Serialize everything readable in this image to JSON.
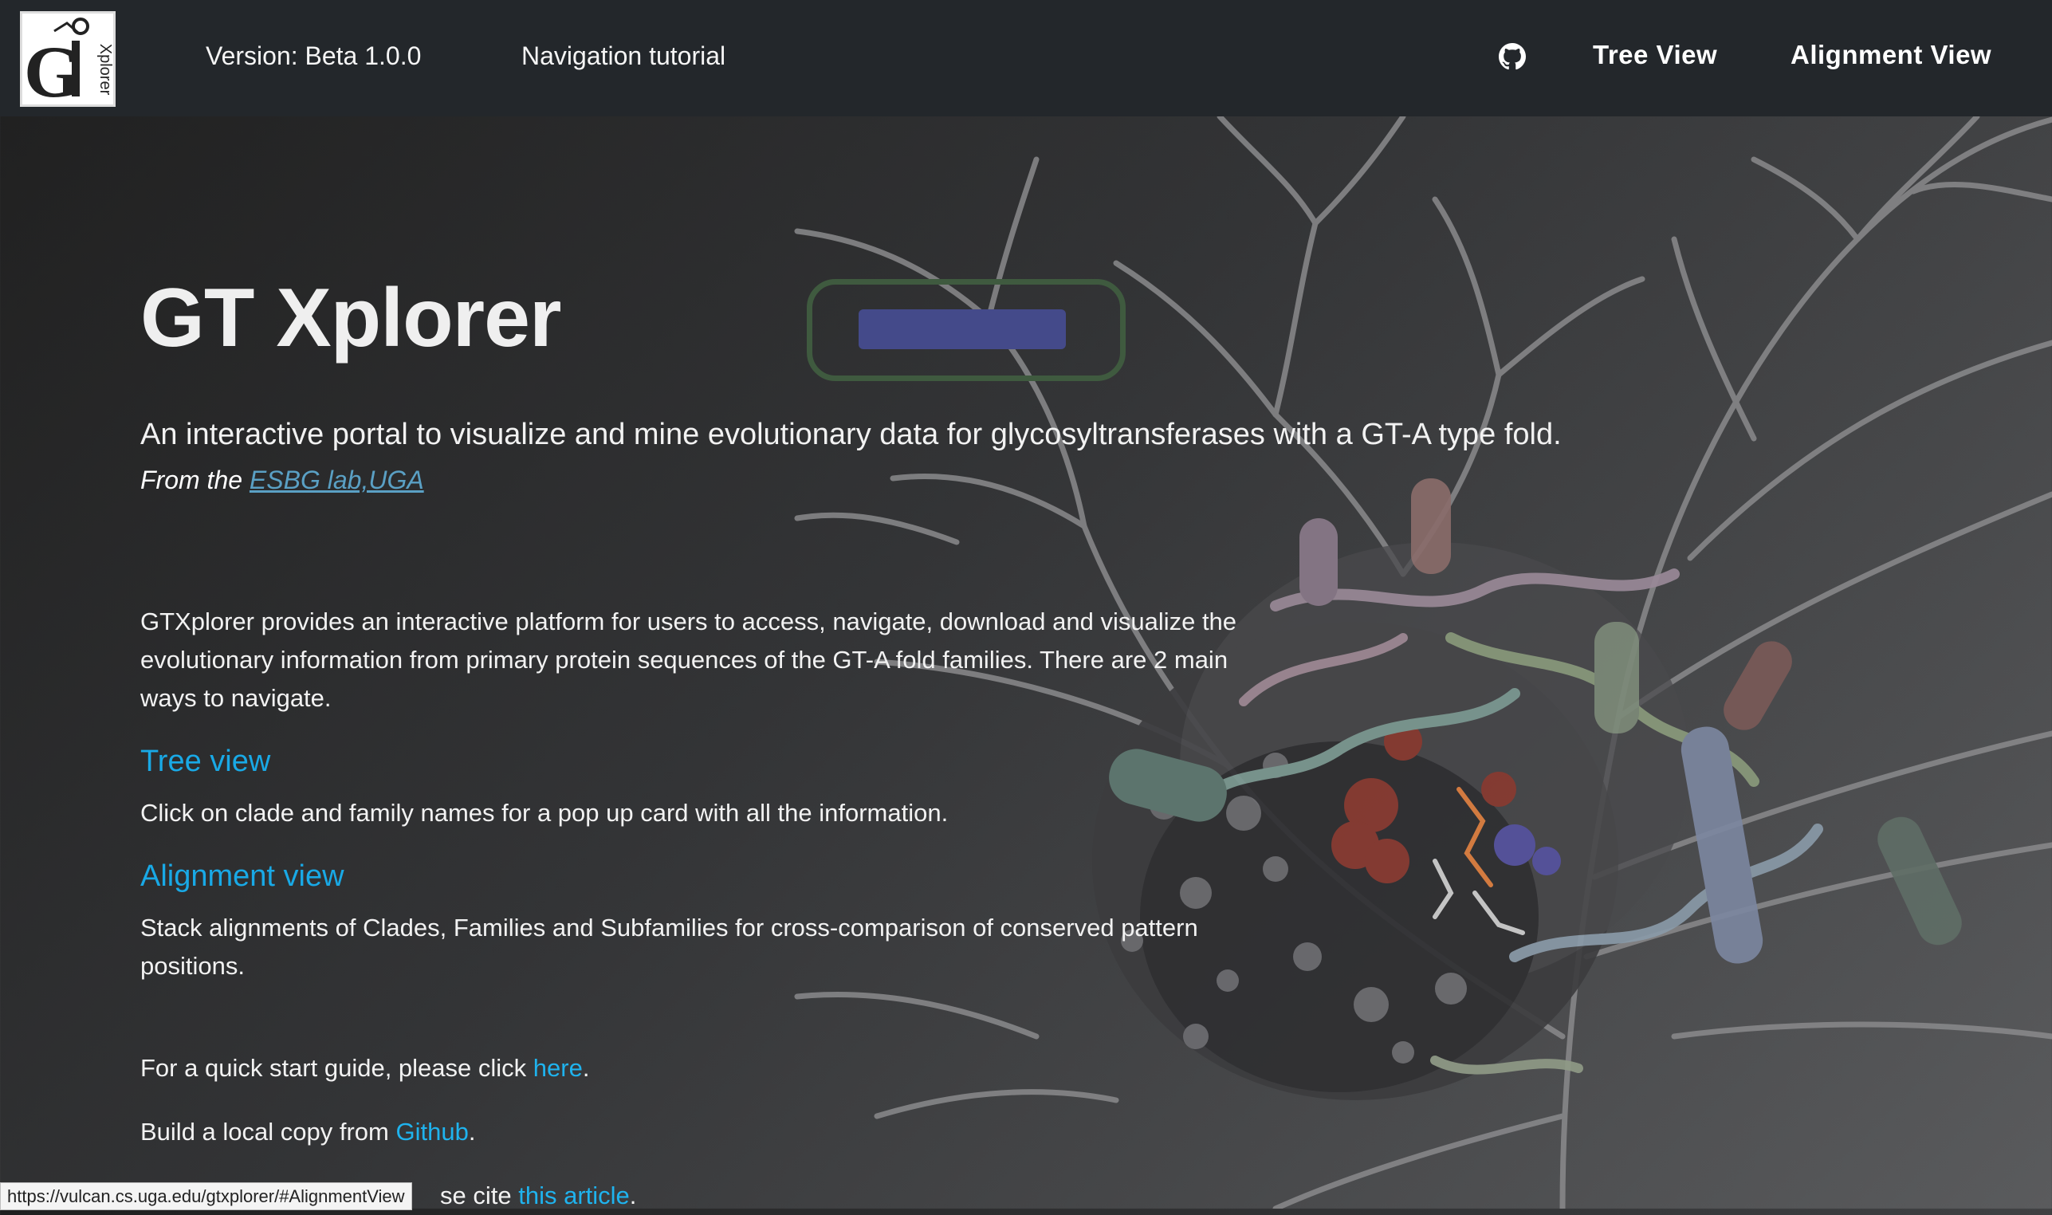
{
  "navbar": {
    "logo_text": "GT Xplorer",
    "version": "Version: Beta 1.0.0",
    "tutorial": "Navigation tutorial",
    "github_icon": "github-icon",
    "tree_view": "Tree View",
    "alignment_view": "Alignment View"
  },
  "hero": {
    "title": "GT Xplorer",
    "subtitle": "An interactive portal to visualize and mine evolutionary data for glycosyltransferases with a GT-A type fold.",
    "from_prefix": "From the ",
    "from_link": "ESBG lab,UGA"
  },
  "intro": {
    "line1": "GTXplorer provides an interactive platform for users to access, navigate, download and visualize the",
    "line2": "evolutionary information from primary protein sequences of the GT-A fold families. There are 2 main",
    "line3": "ways to navigate."
  },
  "tree_section": {
    "heading": "Tree view",
    "text": "Click on clade and family names for a pop up card with all the information."
  },
  "alignment_section": {
    "heading": "Alignment view",
    "line1": "Stack alignments of Clades, Families and Subfamilies for cross-comparison of conserved pattern",
    "line2": "positions."
  },
  "quickstart": {
    "prefix": "For a quick start guide, please click ",
    "link": "here",
    "suffix": "."
  },
  "local_copy": {
    "prefix": "Build a local copy from ",
    "link": "Github",
    "suffix": "."
  },
  "cite": {
    "prefix": "se cite ",
    "link": "this article",
    "suffix": "."
  },
  "status_url": "https://vulcan.cs.uga.edu/gtxplorer/#AlignmentView"
}
